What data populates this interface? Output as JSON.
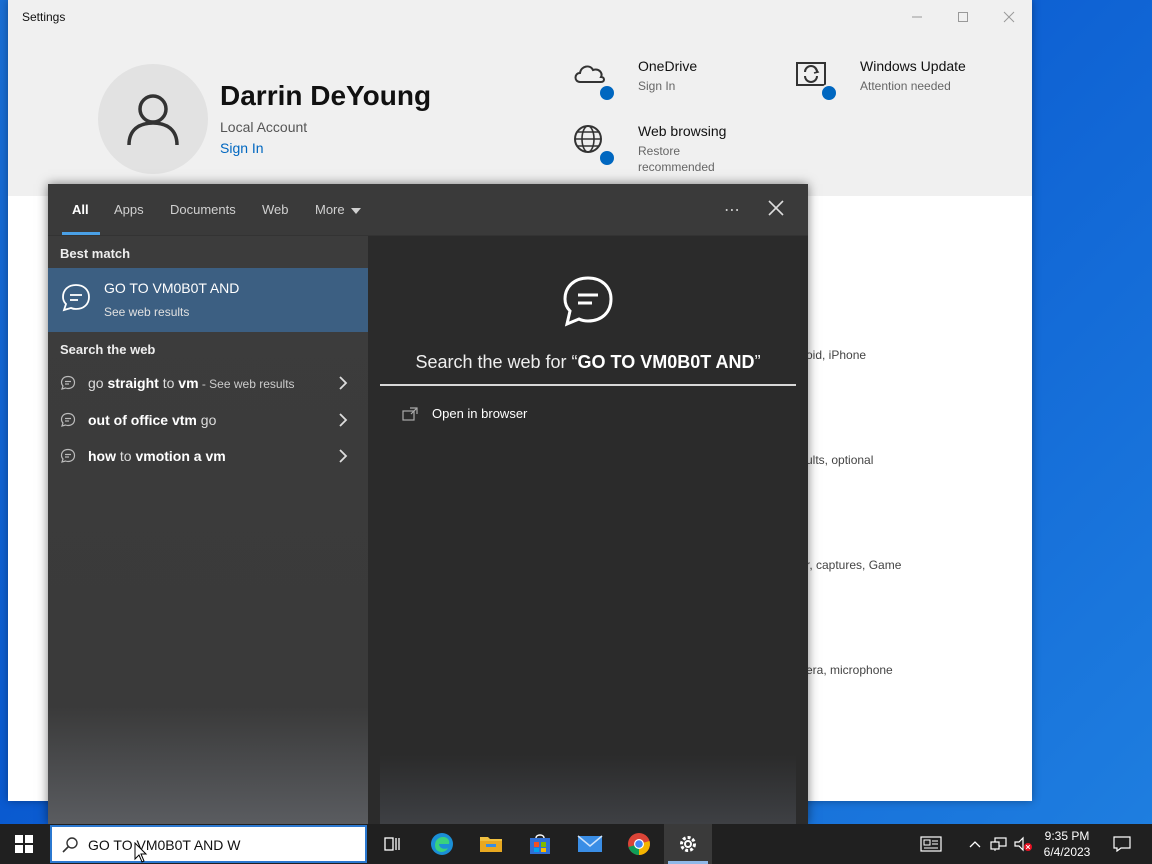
{
  "settings": {
    "title": "Settings",
    "user": {
      "name": "Darrin DeYoung",
      "account_type": "Local Account",
      "sign_in": "Sign In"
    },
    "hero_items": [
      {
        "title": "OneDrive",
        "subtitle": "Sign In",
        "icon": "onedrive-cloud-icon"
      },
      {
        "title": "Windows Update",
        "subtitle": "Attention needed",
        "icon": "windows-update-icon"
      },
      {
        "title": "Web browsing",
        "subtitle": "Restore recommended",
        "icon": "globe-icon"
      }
    ],
    "peek_texts": [
      "oid, iPhone",
      "ults, optional",
      "r, captures, Game",
      "era, microphone"
    ]
  },
  "search": {
    "tabs": [
      "All",
      "Apps",
      "Documents",
      "Web",
      "More"
    ],
    "active_tab": "All",
    "best_match_label": "Best match",
    "best_match": {
      "title": "GO TO VM0B0T AND",
      "subtitle": "See web results"
    },
    "search_web_label": "Search the web",
    "web_results": [
      {
        "pre": "go ",
        "bold": "straight",
        "mid": " to ",
        "bold2": "vm",
        "hint": " - See web results"
      },
      {
        "pre": "",
        "bold": "out of office vtm",
        "mid": " go",
        "bold2": "",
        "hint": ""
      },
      {
        "pre": "",
        "bold": "how",
        "mid": " to ",
        "bold2": "vmotion a vm",
        "hint": ""
      }
    ],
    "preview": {
      "heading_prefix": "Search the web for “",
      "heading_query": "GO TO VM0B0T AND",
      "heading_suffix": "”",
      "open_in_browser": "Open in browser"
    },
    "more_options": "⋯"
  },
  "taskbar": {
    "search_text": "GO TO VM0B0T AND W",
    "time": "9:35 PM",
    "date": "6/4/2023",
    "accent": "#2b78d0"
  }
}
